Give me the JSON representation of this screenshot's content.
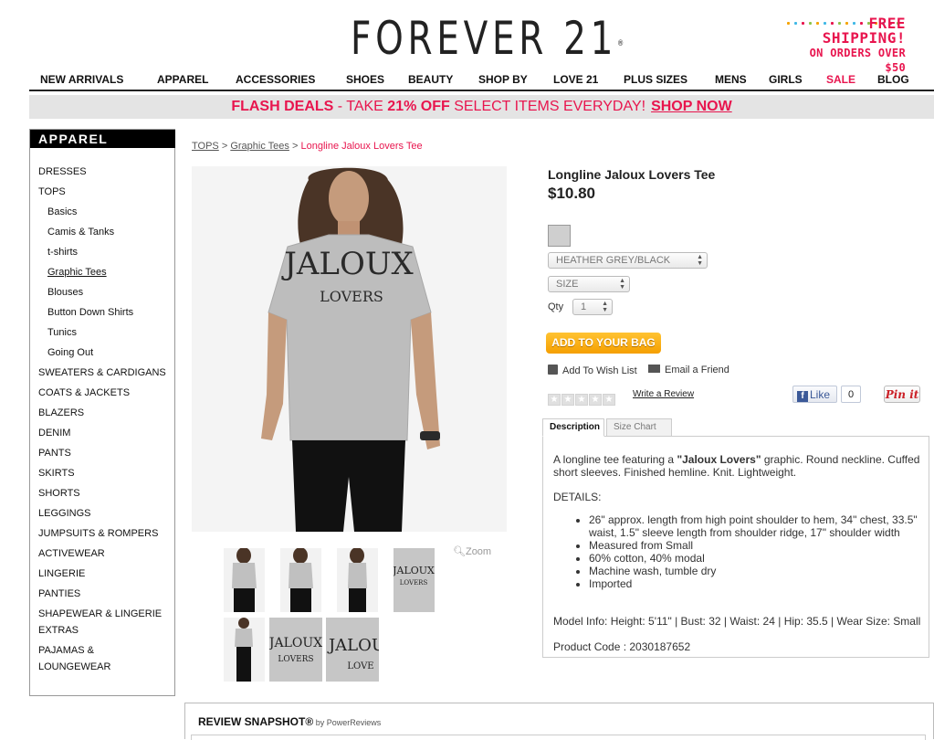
{
  "header": {
    "logo": "FOREVER 21",
    "logo_mark": "®",
    "free_shipping_line1": "FREE SHIPPING!",
    "free_shipping_line2": "ON ORDERS OVER $50"
  },
  "nav": {
    "items": [
      "NEW ARRIVALS",
      "APPAREL",
      "ACCESSORIES",
      "SHOES",
      "BEAUTY",
      "SHOP BY",
      "LOVE 21",
      "PLUS SIZES",
      "MENS",
      "GIRLS",
      "SALE",
      "BLOG"
    ]
  },
  "flash": {
    "lead": "FLASH DEALS",
    "dash": " - TAKE ",
    "pct": "21% OFF",
    "rest": " SELECT ITEMS EVERYDAY!",
    "cta": "SHOP NOW"
  },
  "sidebar": {
    "title": "APPAREL",
    "items": [
      {
        "label": "DRESSES"
      },
      {
        "label": "TOPS"
      },
      {
        "label": "Basics"
      },
      {
        "label": "Camis & Tanks"
      },
      {
        "label": "t-shirts"
      },
      {
        "label": "Graphic Tees"
      },
      {
        "label": "Blouses"
      },
      {
        "label": "Button Down Shirts"
      },
      {
        "label": "Tunics"
      },
      {
        "label": "Going Out"
      },
      {
        "label": "SWEATERS & CARDIGANS"
      },
      {
        "label": "COATS & JACKETS"
      },
      {
        "label": "BLAZERS"
      },
      {
        "label": "DENIM"
      },
      {
        "label": "PANTS"
      },
      {
        "label": "SKIRTS"
      },
      {
        "label": "SHORTS"
      },
      {
        "label": "LEGGINGS"
      },
      {
        "label": "JUMPSUITS & ROMPERS"
      },
      {
        "label": "ACTIVEWEAR"
      },
      {
        "label": "LINGERIE"
      },
      {
        "label": "PANTIES"
      },
      {
        "label": "SHAPEWEAR & LINGERIE"
      },
      {
        "label": "EXTRAS"
      },
      {
        "label": "PAJAMAS &"
      },
      {
        "label": "LOUNGEWEAR"
      }
    ]
  },
  "breadcrumb": {
    "tops": "TOPS",
    "sep": " > ",
    "graphic": "Graphic Tees",
    "current": "Longline Jaloux Lovers Tee"
  },
  "product": {
    "image_text_line1": "JALOUX",
    "image_text_line2": "LOVERS",
    "zoom": "Zoom",
    "title": "Longline Jaloux Lovers Tee",
    "price": "$10.80",
    "color": "HEATHER GREY/BLACK",
    "size": "SIZE",
    "qty_label": "Qty",
    "qty": "1",
    "add_to_bag": "ADD TO YOUR BAG",
    "wish_list": "Add To Wish List",
    "email_friend": "Email a Friend",
    "write_review": "Write a Review",
    "like": "Like",
    "like_count": "0",
    "pin_it": "Pin it"
  },
  "tabs": [
    "Description",
    "Size Chart"
  ],
  "description": {
    "intro_before": "A longline tee featuring a ",
    "intro_bold": "\"Jaloux Lovers\"",
    "intro_after": " graphic. Round neckline. Cuffed short sleeves. Finished hemline. Knit. Lightweight.",
    "details_heading": "DETAILS:",
    "details": [
      "26\" approx. length from high point shoulder to hem, 34\" chest, 33.5\" waist, 1.5\" sleeve length from shoulder ridge, 17\" shoulder width",
      "Measured from Small",
      "60% cotton, 40% modal",
      "Machine wash, tumble dry",
      "Imported"
    ],
    "model_info": "Model Info: Height: 5'11\" | Bust: 32 | Waist: 24 | Hip: 35.5 | Wear Size: Small",
    "product_code": "Product Code : 2030187652"
  },
  "review": {
    "title": "REVIEW SNAPSHOT®",
    "by": " by PowerReviews"
  },
  "colors": {
    "brand_pink": "#e8154e",
    "add_to_bag": "#f5a300",
    "facebook": "#3b5998"
  }
}
